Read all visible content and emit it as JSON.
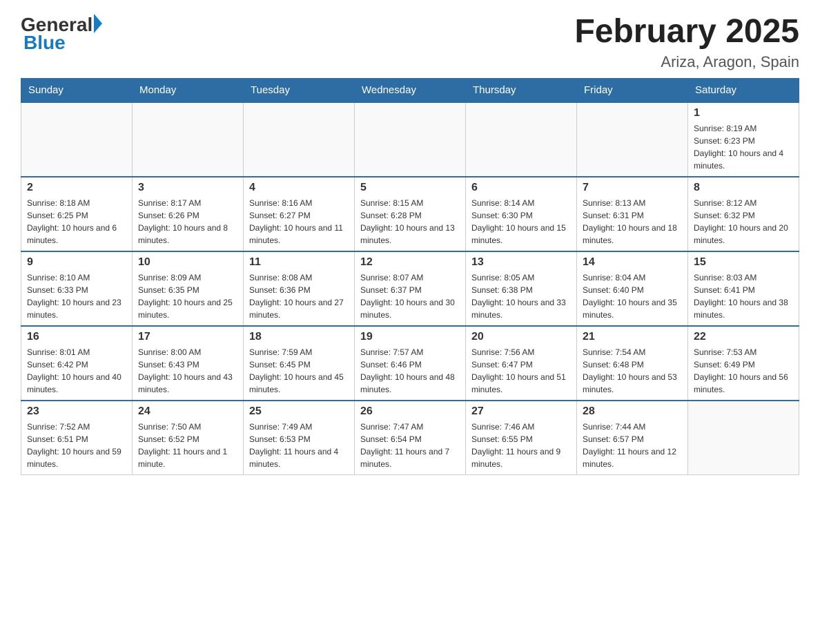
{
  "header": {
    "logo_general": "General",
    "logo_blue": "Blue",
    "month_title": "February 2025",
    "location": "Ariza, Aragon, Spain"
  },
  "weekdays": [
    "Sunday",
    "Monday",
    "Tuesday",
    "Wednesday",
    "Thursday",
    "Friday",
    "Saturday"
  ],
  "weeks": [
    [
      {
        "day": "",
        "info": ""
      },
      {
        "day": "",
        "info": ""
      },
      {
        "day": "",
        "info": ""
      },
      {
        "day": "",
        "info": ""
      },
      {
        "day": "",
        "info": ""
      },
      {
        "day": "",
        "info": ""
      },
      {
        "day": "1",
        "info": "Sunrise: 8:19 AM\nSunset: 6:23 PM\nDaylight: 10 hours and 4 minutes."
      }
    ],
    [
      {
        "day": "2",
        "info": "Sunrise: 8:18 AM\nSunset: 6:25 PM\nDaylight: 10 hours and 6 minutes."
      },
      {
        "day": "3",
        "info": "Sunrise: 8:17 AM\nSunset: 6:26 PM\nDaylight: 10 hours and 8 minutes."
      },
      {
        "day": "4",
        "info": "Sunrise: 8:16 AM\nSunset: 6:27 PM\nDaylight: 10 hours and 11 minutes."
      },
      {
        "day": "5",
        "info": "Sunrise: 8:15 AM\nSunset: 6:28 PM\nDaylight: 10 hours and 13 minutes."
      },
      {
        "day": "6",
        "info": "Sunrise: 8:14 AM\nSunset: 6:30 PM\nDaylight: 10 hours and 15 minutes."
      },
      {
        "day": "7",
        "info": "Sunrise: 8:13 AM\nSunset: 6:31 PM\nDaylight: 10 hours and 18 minutes."
      },
      {
        "day": "8",
        "info": "Sunrise: 8:12 AM\nSunset: 6:32 PM\nDaylight: 10 hours and 20 minutes."
      }
    ],
    [
      {
        "day": "9",
        "info": "Sunrise: 8:10 AM\nSunset: 6:33 PM\nDaylight: 10 hours and 23 minutes."
      },
      {
        "day": "10",
        "info": "Sunrise: 8:09 AM\nSunset: 6:35 PM\nDaylight: 10 hours and 25 minutes."
      },
      {
        "day": "11",
        "info": "Sunrise: 8:08 AM\nSunset: 6:36 PM\nDaylight: 10 hours and 27 minutes."
      },
      {
        "day": "12",
        "info": "Sunrise: 8:07 AM\nSunset: 6:37 PM\nDaylight: 10 hours and 30 minutes."
      },
      {
        "day": "13",
        "info": "Sunrise: 8:05 AM\nSunset: 6:38 PM\nDaylight: 10 hours and 33 minutes."
      },
      {
        "day": "14",
        "info": "Sunrise: 8:04 AM\nSunset: 6:40 PM\nDaylight: 10 hours and 35 minutes."
      },
      {
        "day": "15",
        "info": "Sunrise: 8:03 AM\nSunset: 6:41 PM\nDaylight: 10 hours and 38 minutes."
      }
    ],
    [
      {
        "day": "16",
        "info": "Sunrise: 8:01 AM\nSunset: 6:42 PM\nDaylight: 10 hours and 40 minutes."
      },
      {
        "day": "17",
        "info": "Sunrise: 8:00 AM\nSunset: 6:43 PM\nDaylight: 10 hours and 43 minutes."
      },
      {
        "day": "18",
        "info": "Sunrise: 7:59 AM\nSunset: 6:45 PM\nDaylight: 10 hours and 45 minutes."
      },
      {
        "day": "19",
        "info": "Sunrise: 7:57 AM\nSunset: 6:46 PM\nDaylight: 10 hours and 48 minutes."
      },
      {
        "day": "20",
        "info": "Sunrise: 7:56 AM\nSunset: 6:47 PM\nDaylight: 10 hours and 51 minutes."
      },
      {
        "day": "21",
        "info": "Sunrise: 7:54 AM\nSunset: 6:48 PM\nDaylight: 10 hours and 53 minutes."
      },
      {
        "day": "22",
        "info": "Sunrise: 7:53 AM\nSunset: 6:49 PM\nDaylight: 10 hours and 56 minutes."
      }
    ],
    [
      {
        "day": "23",
        "info": "Sunrise: 7:52 AM\nSunset: 6:51 PM\nDaylight: 10 hours and 59 minutes."
      },
      {
        "day": "24",
        "info": "Sunrise: 7:50 AM\nSunset: 6:52 PM\nDaylight: 11 hours and 1 minute."
      },
      {
        "day": "25",
        "info": "Sunrise: 7:49 AM\nSunset: 6:53 PM\nDaylight: 11 hours and 4 minutes."
      },
      {
        "day": "26",
        "info": "Sunrise: 7:47 AM\nSunset: 6:54 PM\nDaylight: 11 hours and 7 minutes."
      },
      {
        "day": "27",
        "info": "Sunrise: 7:46 AM\nSunset: 6:55 PM\nDaylight: 11 hours and 9 minutes."
      },
      {
        "day": "28",
        "info": "Sunrise: 7:44 AM\nSunset: 6:57 PM\nDaylight: 11 hours and 12 minutes."
      },
      {
        "day": "",
        "info": ""
      }
    ]
  ]
}
